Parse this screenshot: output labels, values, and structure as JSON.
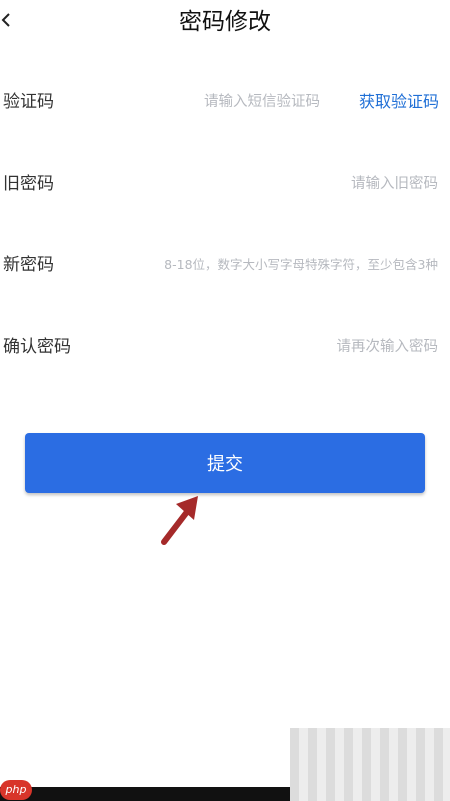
{
  "header": {
    "title": "密码修改",
    "back_icon": "chevron-left-icon"
  },
  "form": {
    "sms_code": {
      "label": "验证码",
      "placeholder": "请输入短信验证码",
      "value": "",
      "get_code_label": "获取验证码"
    },
    "old_password": {
      "label": "旧密码",
      "placeholder": "请输入旧密码",
      "value": ""
    },
    "new_password": {
      "label": "新密码",
      "placeholder": "8-18位，数字大小写字母特殊字符，至少包含3种",
      "value": ""
    },
    "confirm_password": {
      "label": "确认密码",
      "placeholder": "请再次输入密码",
      "value": ""
    }
  },
  "submit": {
    "label": "提交"
  },
  "watermark": {
    "logo": "php"
  },
  "colors": {
    "accent": "#2b6de3",
    "link": "#1f6fd6",
    "annotation_arrow": "#a52a2a"
  }
}
